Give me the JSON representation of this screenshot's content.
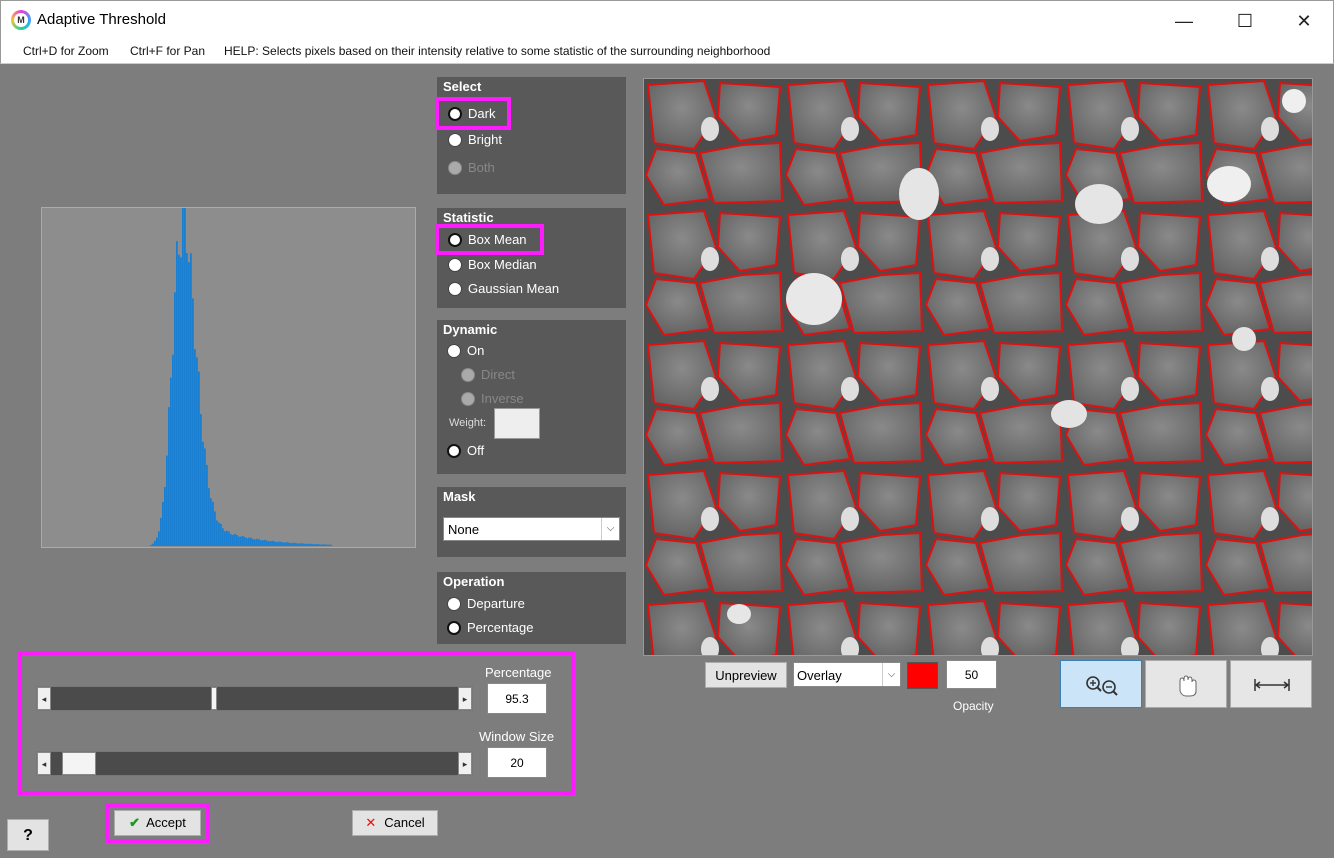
{
  "window": {
    "title": "Adaptive Threshold",
    "minimize": "—",
    "maximize": "☐",
    "close": "✕"
  },
  "hints": {
    "zoom": "Ctrl+D for Zoom",
    "pan": "Ctrl+F for Pan",
    "help": "HELP:  Selects pixels based on their intensity relative to some statistic of the surrounding neighborhood"
  },
  "select": {
    "title": "Select",
    "options": [
      {
        "label": "Dark",
        "selected": true,
        "enabled": true
      },
      {
        "label": "Bright",
        "selected": false,
        "enabled": true
      },
      {
        "label": "Both",
        "selected": false,
        "enabled": false
      }
    ]
  },
  "statistic": {
    "title": "Statistic",
    "options": [
      {
        "label": "Box Mean",
        "selected": true
      },
      {
        "label": "Box Median",
        "selected": false
      },
      {
        "label": "Gaussian Mean",
        "selected": false
      }
    ]
  },
  "dynamic": {
    "title": "Dynamic",
    "on_label": "On",
    "direct_label": "Direct",
    "inverse_label": "Inverse",
    "weight_label": "Weight:",
    "weight_value": "",
    "off_label": "Off",
    "selected": "Off"
  },
  "mask": {
    "title": "Mask",
    "selected": "None"
  },
  "operation": {
    "title": "Operation",
    "options": [
      {
        "label": "Departure",
        "selected": false
      },
      {
        "label": "Percentage",
        "selected": true
      }
    ]
  },
  "sliders": {
    "percentage_label": "Percentage",
    "percentage_value": "95.3",
    "percentage_fraction": 0.4,
    "window_label": "Window Size",
    "window_value": "20",
    "window_fraction": 0.03
  },
  "preview": {
    "unpreview_label": "Unpreview",
    "mode_selected": "Overlay",
    "overlay_color": "#ff0000",
    "opacity_value": "50",
    "opacity_label": "Opacity"
  },
  "tools": {
    "zoom_icon": "zoom-in-out-icon",
    "pan_icon": "hand-icon",
    "fit_icon": "fit-width-icon"
  },
  "footer": {
    "help_label": "?",
    "accept_label": "Accept",
    "cancel_label": "Cancel"
  },
  "colors": {
    "highlight": "#ff1bff",
    "histogram_bar": "#1a7fd0",
    "overlay": "#ff0000"
  }
}
